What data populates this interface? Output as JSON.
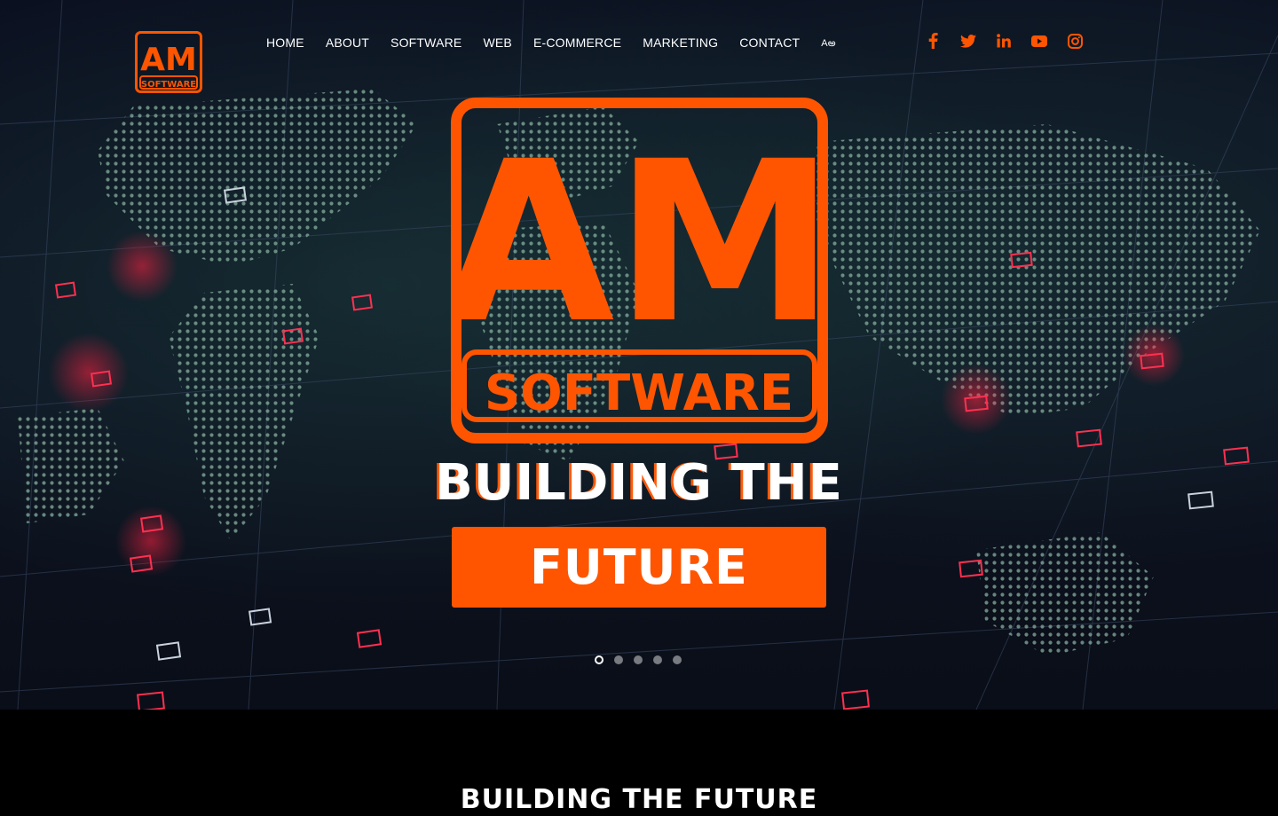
{
  "brand": {
    "logo_top": "AM",
    "logo_bottom": "SOFTWARE",
    "accent": "#ff5500"
  },
  "nav": {
    "items": [
      {
        "label": "HOME"
      },
      {
        "label": "ABOUT"
      },
      {
        "label": "SOFTWARE"
      },
      {
        "label": "WEB"
      },
      {
        "label": "E-COMMERCE"
      },
      {
        "label": "MARKETING"
      },
      {
        "label": "CONTACT"
      }
    ],
    "language_icon": "translate-icon",
    "language_label": "Aఅ"
  },
  "social": [
    {
      "icon": "facebook-icon"
    },
    {
      "icon": "twitter-icon"
    },
    {
      "icon": "linkedin-icon"
    },
    {
      "icon": "youtube-icon"
    },
    {
      "icon": "instagram-icon"
    }
  ],
  "hero": {
    "headline": "BUILDING THE",
    "highlight": "FUTURE",
    "slides": 5,
    "active_slide": 1
  },
  "section": {
    "title": "BUILDING THE FUTURE"
  }
}
